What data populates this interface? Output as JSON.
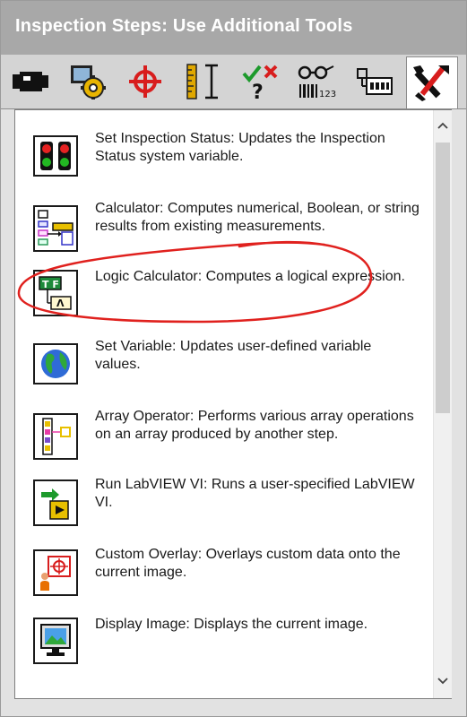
{
  "title": "Inspection Steps: Use Additional Tools",
  "tabs": [
    {
      "icon": "acquire-image-icon",
      "active": false
    },
    {
      "icon": "image-processing-gear-icon",
      "active": false
    },
    {
      "icon": "locate-crosshair-icon",
      "active": false
    },
    {
      "icon": "measure-ruler-icon",
      "active": false
    },
    {
      "icon": "check-pass-fail-icon",
      "active": false
    },
    {
      "icon": "identify-barcode-icon",
      "active": false
    },
    {
      "icon": "communicate-io-icon",
      "active": false
    },
    {
      "icon": "additional-tools-icon",
      "active": true
    }
  ],
  "items": [
    {
      "label": "Set Inspection Status:  Updates the Inspection Status system variable.",
      "icon": "traffic-light-icon"
    },
    {
      "label": "Calculator:  Computes numerical, Boolean, or string results from existing measurements.",
      "icon": "calculator-icon"
    },
    {
      "label": "Logic Calculator:  Computes a logical expression.",
      "icon": "logic-calculator-icon"
    },
    {
      "label": "Set Variable:  Updates user-defined variable values.",
      "icon": "globe-icon"
    },
    {
      "label": "Array Operator:  Performs various array operations on an array produced by another step.",
      "icon": "array-icon"
    },
    {
      "label": "Run LabVIEW VI:  Runs a user-specified LabVIEW VI.",
      "icon": "labview-vi-icon"
    },
    {
      "label": "Custom Overlay:  Overlays custom data onto the current image.",
      "icon": "overlay-icon"
    },
    {
      "label": "Display Image:  Displays the current image.",
      "icon": "monitor-icon"
    }
  ],
  "scrollbar": {
    "up_arrow": "⌃",
    "down_arrow": "⌄"
  },
  "colors": {
    "title_bar": "#a8a8a8",
    "highlight": "#e0211e"
  }
}
